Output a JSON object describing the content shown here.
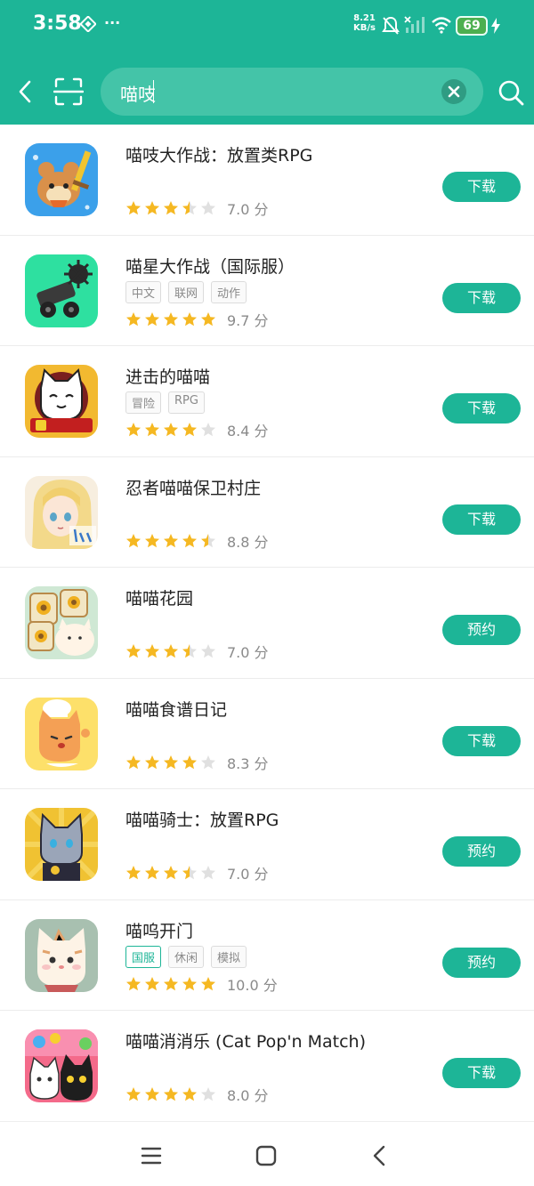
{
  "status_bar": {
    "time": "3:58",
    "more": "···",
    "net_speed_value": "8.21",
    "net_speed_unit": "KB/s",
    "battery": "69"
  },
  "search": {
    "query": "喵吱"
  },
  "apps": [
    {
      "name": "喵吱大作战：放置类RPG",
      "tags": [],
      "stars": 3.5,
      "score": "7.0 分",
      "action": "下载",
      "icon": "hamster-warrior-icon"
    },
    {
      "name": "喵星大作战（国际服）",
      "tags": [
        {
          "label": "中文"
        },
        {
          "label": "联网"
        },
        {
          "label": "动作"
        }
      ],
      "stars": 5,
      "score": "9.7 分",
      "action": "下载",
      "icon": "cannon-cart-icon"
    },
    {
      "name": "进击的喵喵",
      "tags": [
        {
          "label": "冒险"
        },
        {
          "label": "RPG"
        }
      ],
      "stars": 4,
      "score": "8.4 分",
      "action": "下载",
      "icon": "white-cat-6th-anniversary-icon"
    },
    {
      "name": "忍者喵喵保卫村庄",
      "tags": [],
      "stars": 4.5,
      "score": "8.8 分",
      "action": "下载",
      "icon": "anime-girl-1st-anniv-icon"
    },
    {
      "name": "喵喵花园",
      "tags": [],
      "stars": 3.5,
      "score": "7.0 分",
      "action": "预约",
      "icon": "sunflower-tiles-cat-icon"
    },
    {
      "name": "喵喵食谱日记",
      "tags": [],
      "stars": 4,
      "score": "8.3 分",
      "action": "下载",
      "icon": "chef-cat-icon"
    },
    {
      "name": "喵喵骑士：放置RPG",
      "tags": [],
      "stars": 3.5,
      "score": "7.0 分",
      "action": "预约",
      "icon": "knight-cat-icon"
    },
    {
      "name": "喵呜开门",
      "tags": [
        {
          "label": "国服",
          "accent": true
        },
        {
          "label": "休闲"
        },
        {
          "label": "模拟"
        }
      ],
      "stars": 5,
      "score": "10.0 分",
      "action": "预约",
      "icon": "cute-cat-icon"
    },
    {
      "name": "喵喵消消乐 (Cat Pop'n Match)",
      "tags": [],
      "stars": 4,
      "score": "8.0 分",
      "action": "下载",
      "icon": "cat-pop-match-icon"
    }
  ],
  "colors": {
    "brand": "#1db597",
    "star": "#f5b822",
    "star_empty": "#e0e0e0"
  }
}
